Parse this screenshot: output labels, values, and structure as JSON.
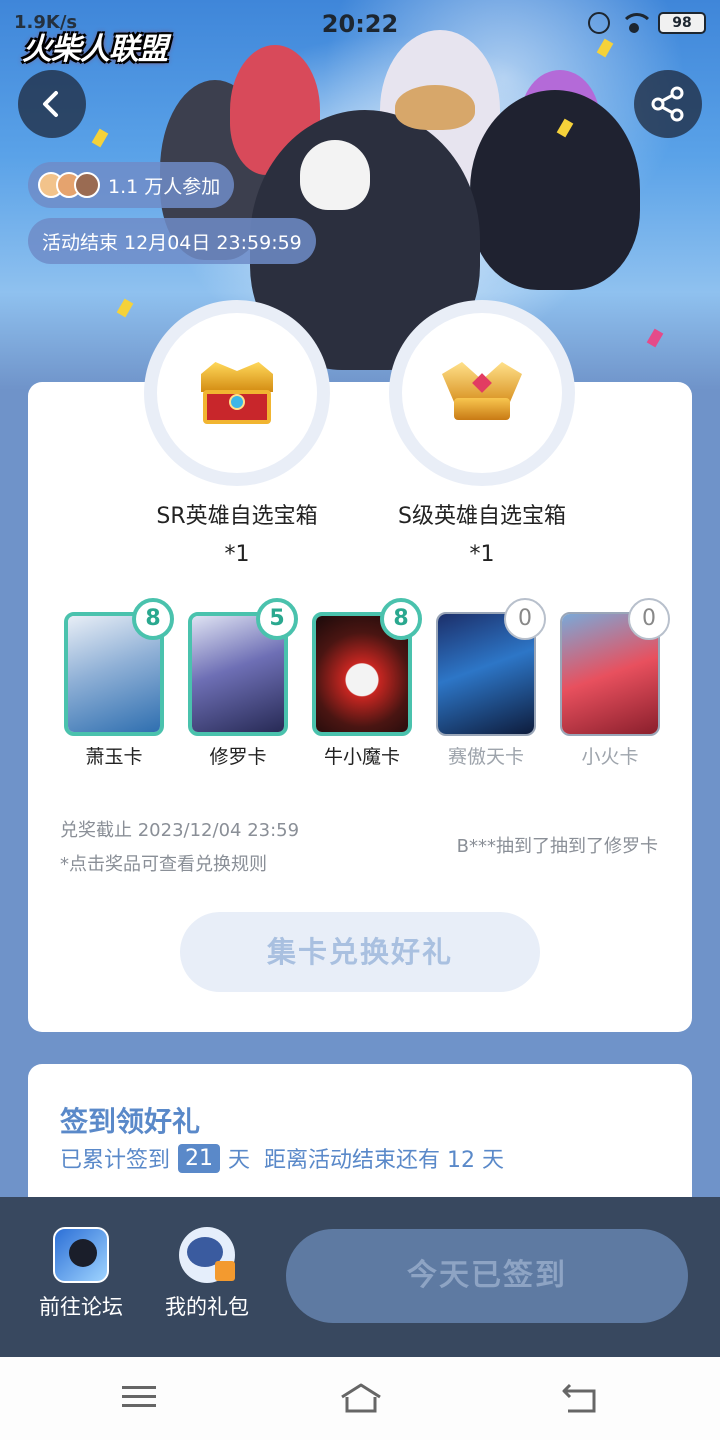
{
  "status_bar": {
    "left_text": "1.9K/s",
    "time": "20:22",
    "battery": "98"
  },
  "hero": {
    "game_logo": "火柴人联盟",
    "participants": "1.1 万人参加",
    "event_end": "活动结束 12月04日 23:59:59"
  },
  "rewards": [
    {
      "name": "SR英雄自选宝箱",
      "qty": "*1"
    },
    {
      "name": "S级英雄自选宝箱",
      "qty": "*1"
    }
  ],
  "hero_cards": [
    {
      "name": "萧玉卡",
      "count": "8",
      "owned": true
    },
    {
      "name": "修罗卡",
      "count": "5",
      "owned": true
    },
    {
      "name": "牛小魔卡",
      "count": "8",
      "owned": true
    },
    {
      "name": "赛傲天卡",
      "count": "0",
      "owned": false
    },
    {
      "name": "小火卡",
      "count": "0",
      "owned": false
    }
  ],
  "redeem": {
    "deadline": "兑奖截止 2023/12/04 23:59",
    "hint": "*点击奖品可查看兑换规则",
    "ticker": "B***抽到了抽到了修罗卡",
    "exchange_button": "集卡兑换好礼"
  },
  "sign_in": {
    "title": "签到领好礼",
    "prefix": "已累计签到",
    "days": "21",
    "suffix": "天  距离活动结束还有 12 天"
  },
  "action_bar": {
    "forum_label": "前往论坛",
    "gift_label": "我的礼包",
    "checkin_button": "今天已签到"
  },
  "colors": {
    "accent": "#5a89c9",
    "owned_border": "#4ac2ad",
    "action_bar_bg": "#38485f"
  },
  "icons": [
    "back-arrow-icon",
    "share-icon",
    "alarm-icon",
    "wifi-icon",
    "battery-icon",
    "menu-icon",
    "home-icon",
    "back-icon"
  ]
}
